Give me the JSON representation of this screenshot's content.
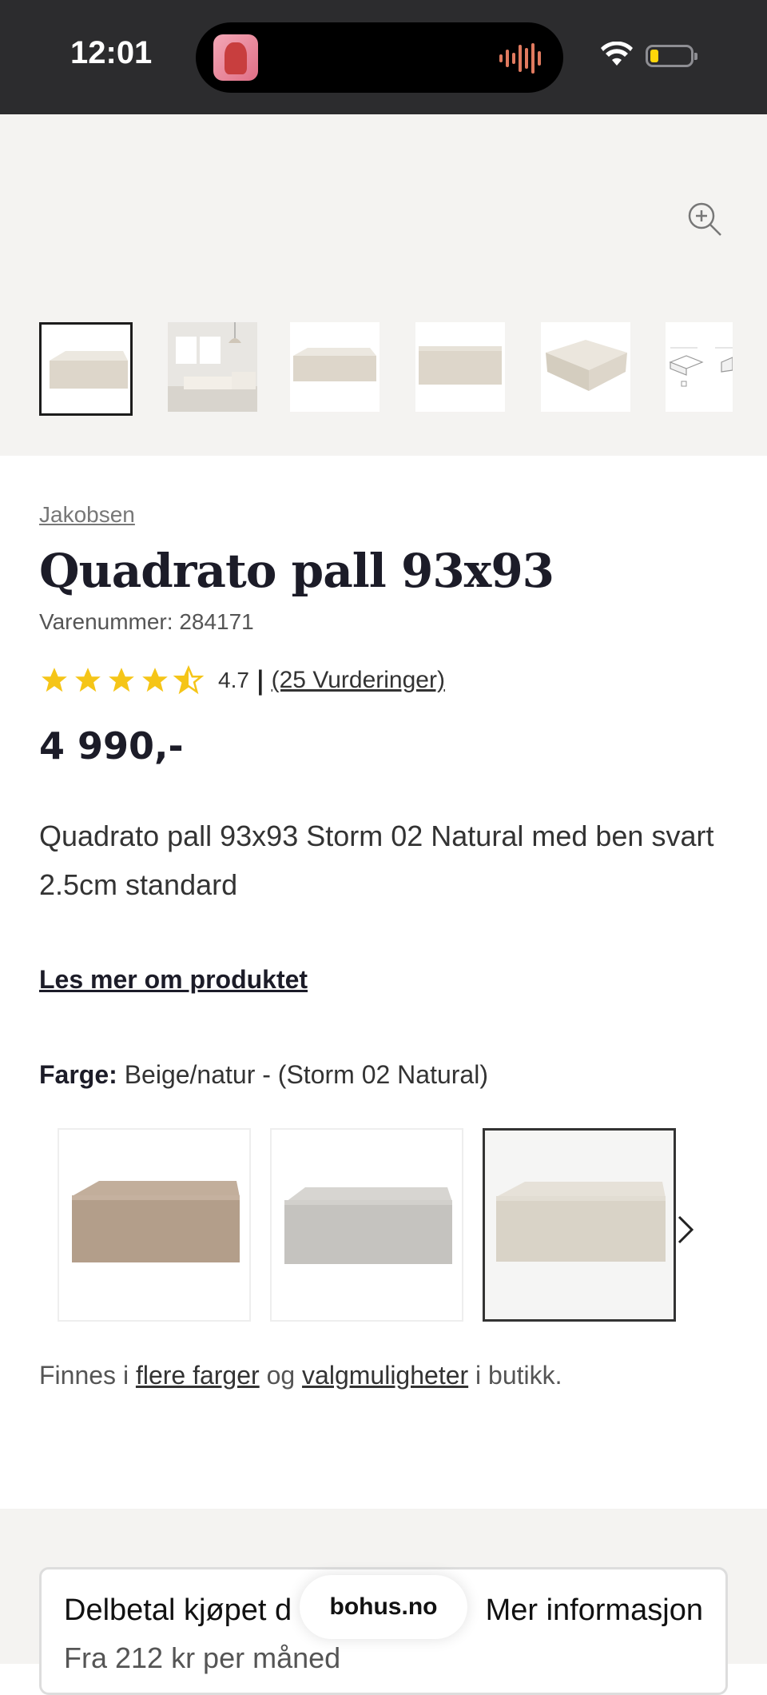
{
  "status": {
    "time": "12:01"
  },
  "product": {
    "brand": "Jakobsen",
    "title": "Quadrato pall 93x93",
    "sku": "Varenummer: 284171",
    "rating_value": "4.7",
    "rating_stars": 4.5,
    "separator": "|",
    "reviews": "(25 Vurderinger)",
    "price": "4 990,-",
    "description": "Quadrato pall 93x93 Storm 02 Natural med ben svart 2.5cm standard",
    "read_more": "Les mer om produktet",
    "color_label": "Farge:",
    "color_value": "Beige/natur - (Storm 02 Natural)",
    "availability": {
      "prefix": "Finnes i",
      "link1": "flere farger",
      "mid": "og",
      "link2": "valgmuligheter",
      "suffix": "i butikk."
    }
  },
  "swatches": [
    {
      "name": "Brun",
      "color": "#b7a28f"
    },
    {
      "name": "Grå",
      "color": "#c9c7c3"
    },
    {
      "name": "Beige/natur",
      "color": "#d8d2c6",
      "selected": true
    }
  ],
  "payment_card": {
    "title": "Delbetal kjøpet d",
    "link": "Mer informasjon",
    "subtitle": "Fra 212 kr per måned"
  },
  "browser": {
    "url": "bohus.no"
  },
  "colors": {
    "star": "#f5c518",
    "text_dark": "#1c1c28",
    "gallery_bg": "#f4f3f1"
  }
}
